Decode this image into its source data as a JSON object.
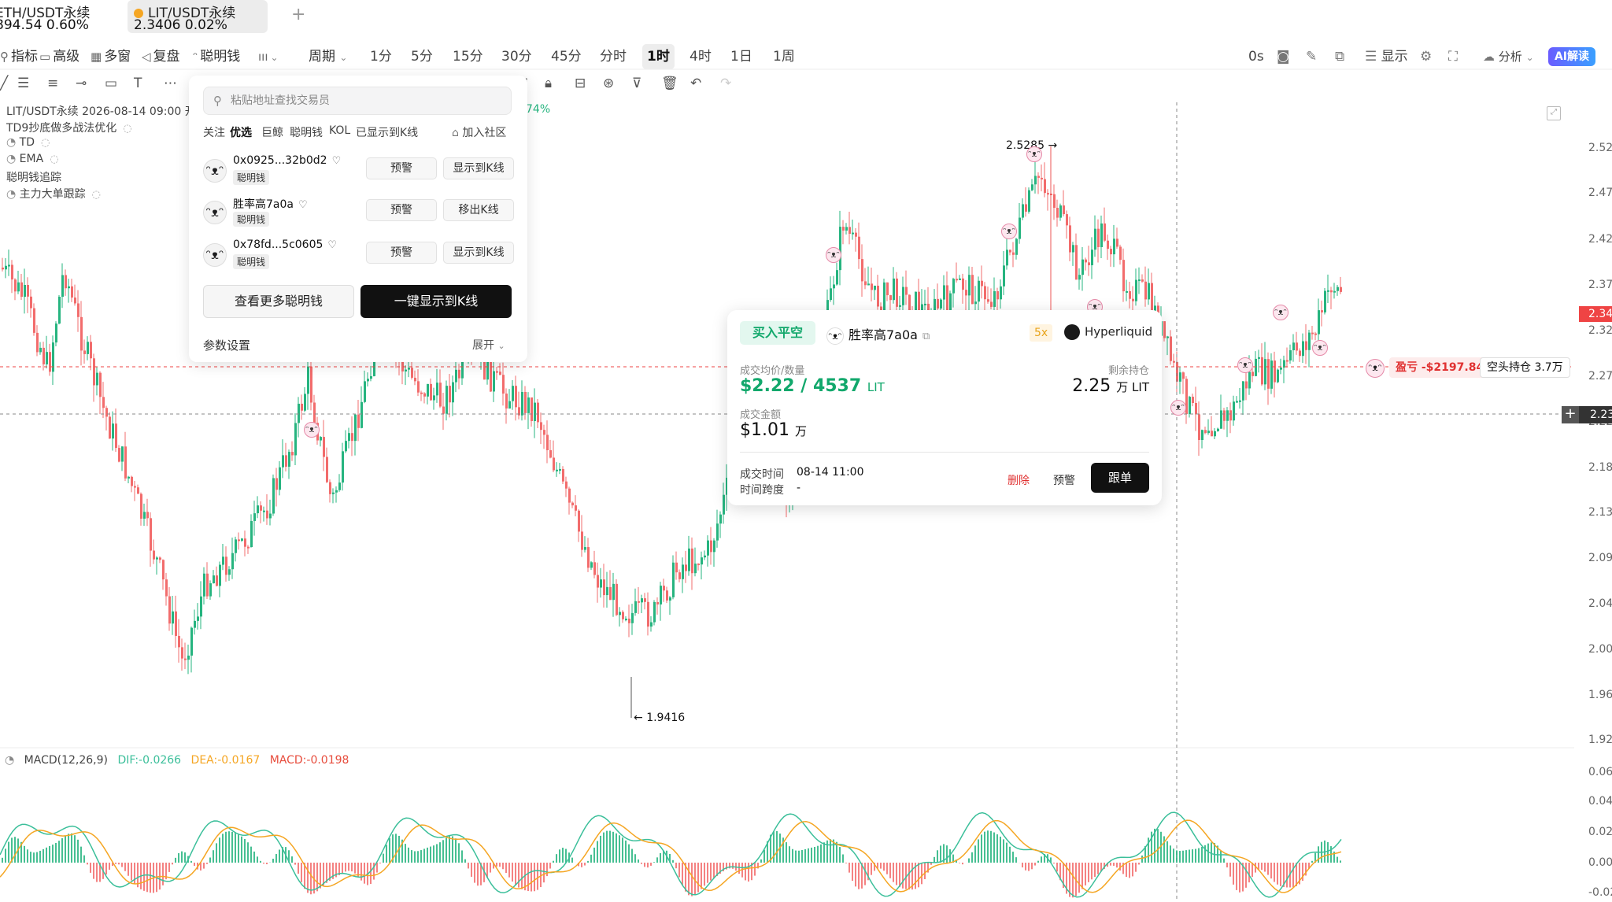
{
  "tabs": [
    {
      "symbol": "ETH/USDT永续",
      "price": "894.54",
      "change": "0.60%"
    },
    {
      "symbol": "LIT/USDT永续",
      "price": "2.3406",
      "change": "0.02%"
    }
  ],
  "tab_add": "+",
  "toolbar": {
    "indicators": "指标",
    "advanced": "高级",
    "multi_window": "多窗",
    "replay": "复盘",
    "smart_money": "聪明钱",
    "period": "周期",
    "intervals": [
      "1分",
      "5分",
      "15分",
      "30分",
      "45分",
      "分时",
      "1时",
      "4时",
      "1日",
      "1周"
    ],
    "active_interval": "1时",
    "countdown": "0s",
    "display": "显示",
    "analysis": "分析",
    "ai": "AI解读"
  },
  "legend": {
    "symbol_line": "LIT/USDT永续  2026-08-14 09:00  开",
    "change_pct": "74%",
    "indicators": [
      "TD9抄底做多战法优化",
      "TD",
      "EMA",
      "聪明钱追踪",
      "主力大单跟踪"
    ]
  },
  "price_axis": [
    "2.52",
    "2.47",
    "2.42",
    "2.37",
    "2.32",
    "2.27",
    "2.22",
    "2.18",
    "2.13",
    "2.09",
    "2.04",
    "2.00",
    "1.96",
    "1.92"
  ],
  "current_price": "2.34",
  "crosshair_price": "2.23",
  "macd_axis": [
    "0.06",
    "0.04",
    "0.02",
    "0.00",
    "-0.02"
  ],
  "annotations": {
    "high": "2.5285",
    "low": "1.9416"
  },
  "macd": {
    "label": "MACD(12,26,9)",
    "dif": "DIF:-0.0266",
    "dea": "DEA:-0.0167",
    "macd": "MACD:-0.0198"
  },
  "colors": {
    "up": "#26b47f",
    "down": "#f26c6c",
    "macd_dif": "#3bbf9a",
    "macd_dea": "#f5a623",
    "macd_val": "#e74c3c"
  },
  "smart_money_panel": {
    "search_placeholder": "粘贴地址查找交易员",
    "filters": [
      "关注",
      "优选",
      "巨鲸",
      "聪明钱",
      "KOL",
      "已显示到K线"
    ],
    "active_filter": "优选",
    "community": "加入社区",
    "traders": [
      {
        "address": "0x0925...32b0d2",
        "tag": "聪明钱",
        "alert": "预警",
        "action": "显示到K线"
      },
      {
        "address": "胜率高7a0a",
        "tag": "聪明钱",
        "alert": "预警",
        "action": "移出K线"
      },
      {
        "address": "0x78fd...5c0605",
        "tag": "聪明钱",
        "alert": "预警",
        "action": "显示到K线"
      }
    ],
    "more_button": "查看更多聪明钱",
    "show_all_button": "一键显示到K线",
    "params": "参数设置",
    "expand": "展开"
  },
  "trade_card": {
    "action": "买入平空",
    "trader": "胜率高7a0a",
    "leverage": "5x",
    "exchange": "Hyperliquid",
    "avg_label": "成交均价/数量",
    "avg_value": "$2.22 / 4537",
    "avg_unit": "LIT",
    "remain_label": "剩余持仓",
    "remain_value": "2.25",
    "remain_unit": "万 LIT",
    "amount_label": "成交金额",
    "amount_value": "$1.01",
    "amount_unit": "万",
    "time_label": "成交时间",
    "time_value": "08-14 11:00",
    "span_label": "时间跨度",
    "span_value": "-",
    "delete": "删除",
    "alert": "预警",
    "follow": "跟单"
  },
  "pnl": {
    "label": "盈亏 -$2197.84",
    "position": "空头持仓 3.7万"
  }
}
